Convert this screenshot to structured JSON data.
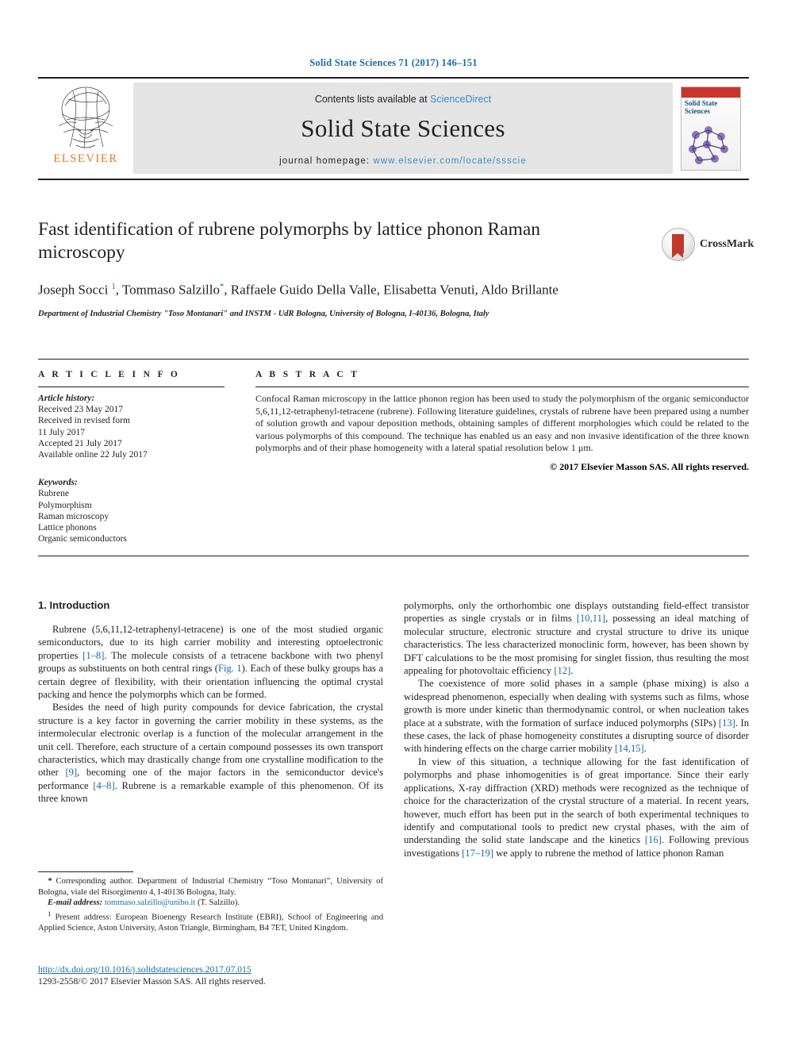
{
  "running_head": "Solid State Sciences 71 (2017) 146–151",
  "masthead": {
    "publisher_name": "ELSEVIER",
    "contents_prefix": "Contents lists available at ",
    "contents_link": "ScienceDirect",
    "journal_title": "Solid State Sciences",
    "homepage_prefix": "journal homepage: ",
    "homepage_url": "www.elsevier.com/locate/ssscie",
    "cover_title": "Solid State Sciences"
  },
  "article": {
    "title": "Fast identification of rubrene polymorphs by lattice phonon Raman microscopy",
    "crossmark_label": "CrossMark",
    "authors_html": "Joseph Socci <sup>1</sup>, Tommaso Salzillo<sup>*</sup>, Raffaele Guido Della Valle, Elisabetta Venuti, Aldo Brillante",
    "affiliation": "Department of Industrial Chemistry \"Toso Montanari\" and INSTM - UdR Bologna, University of Bologna, I-40136, Bologna, Italy"
  },
  "article_info": {
    "heading": "A R T I C L E  I N F O",
    "history_label": "Article history:",
    "history": [
      "Received 23 May 2017",
      "Received in revised form",
      "11 July 2017",
      "Accepted 21 July 2017",
      "Available online 22 July 2017"
    ],
    "keywords_label": "Keywords:",
    "keywords": [
      "Rubrene",
      "Polymorphism",
      "Raman microscopy",
      "Lattice phonons",
      "Organic semiconductors"
    ]
  },
  "abstract": {
    "heading": "A B S T R A C T",
    "text": "Confocal Raman microscopy in the lattice phonon region has been used to study the polymorphism of the organic semiconductor 5,6,11,12-tetraphenyl-tetracene (rubrene). Following literature guidelines, crystals of rubrene have been prepared using a number of solution growth and vapour deposition methods, obtaining samples of different morphologies which could be related to the various polymorphs of this compound. The technique has enabled us an easy and non invasive identification of the three known polymorphs and of their phase homogeneity with a lateral spatial resolution below 1 μm.",
    "copyright": "© 2017 Elsevier Masson SAS. All rights reserved."
  },
  "body": {
    "section_title": "1. Introduction",
    "left_paragraphs_html": [
      "Rubrene (5,6,11,12-tetraphenyl-tetracene) is one of the most studied organic semiconductors, due to its high carrier mobility and interesting optoelectronic properties <span class=\"ref\">[1&#8211;8]</span>. The molecule consists of a tetracene backbone with two phenyl groups as substituents on both central rings (<span class=\"ref\">Fig. 1</span>). Each of these bulky groups has a certain degree of flexibility, with their orientation influencing the optimal crystal packing and hence the polymorphs which can be formed.",
      "Besides the need of high purity compounds for device fabrication, the crystal structure is a key factor in governing the carrier mobility in these systems, as the intermolecular electronic overlap is a function of the molecular arrangement in the unit cell. Therefore, each structure of a certain compound possesses its own transport characteristics, which may drastically change from one crystalline modification to the other <span class=\"ref\">[9]</span>, becoming one of the major factors in the semiconductor device's performance <span class=\"ref\">[4&#8211;8]</span>. Rubrene is a remarkable example of this phenomenon. Of its three known"
    ],
    "right_paragraphs_html": [
      "polymorphs, only the orthorhombic one displays outstanding field-effect transistor properties as single crystals or in films <span class=\"ref\">[10,11]</span>, possessing an ideal matching of molecular structure, electronic structure and crystal structure to drive its unique characteristics. The less characterized monoclinic form, however, has been shown by DFT calculations to be the most promising for singlet fission, thus resulting the most appealing for photovoltaic efficiency <span class=\"ref\">[12]</span>.",
      "The coexistence of more solid phases in a sample (phase mixing) is also a widespread phenomenon, especially when dealing with systems such as films, whose growth is more under kinetic than thermodynamic control, or when nucleation takes place at a substrate, with the formation of surface induced polymorphs (SIPs) <span class=\"ref\">[13]</span>. In these cases, the lack of phase homogeneity constitutes a disrupting source of disorder with hindering effects on the charge carrier mobility <span class=\"ref\">[14,15]</span>.",
      "In view of this situation, a technique allowing for the fast identification of polymorphs and phase inhomogenities is of great importance. Since their early applications, X-ray diffraction (XRD) methods were recognized as the technique of choice for the characterization of the crystal structure of a material. In recent years, however, much effort has been put in the search of both experimental techniques to identify and computational tools to predict new crystal phases, with the aim of understanding the solid state landscape and the kinetics <span class=\"ref\">[16]</span>. Following previous investigations <span class=\"ref\">[17&#8211;19]</span> we apply to rubrene the method of lattice phonon Raman"
    ]
  },
  "footnotes": {
    "corresponding_html": "<span class=\"em\">*</span> Corresponding author. Department of Industrial Chemistry &#8220;Toso Montanari&#8221;, University of Bologna, viale del Risorgimento 4, I-40136 Bologna, Italy.",
    "email_html": "<span class=\"em\">E-mail address:</span> <span class=\"link\">tommaso.salzillo@unibo.it</span> (T. Salzillo).",
    "present_address_html": "<sup>1</sup> Present address: European Bioenergy Research Institute (EBRI), School of Engineering and Applied Science, Aston University, Aston Triangle, Birmingham, B4 7ET, United Kingdom."
  },
  "footer": {
    "doi": "http://dx.doi.org/10.1016/j.solidstatesciences.2017.07.015",
    "issn_line": "1293-2558/© 2017 Elsevier Masson SAS. All rights reserved."
  },
  "colors": {
    "link_blue": "#1a6ba0",
    "sciencedirect_blue": "#3c8bc4",
    "elsevier_orange": "#e87722",
    "crossmark_red": "#c0392b"
  }
}
